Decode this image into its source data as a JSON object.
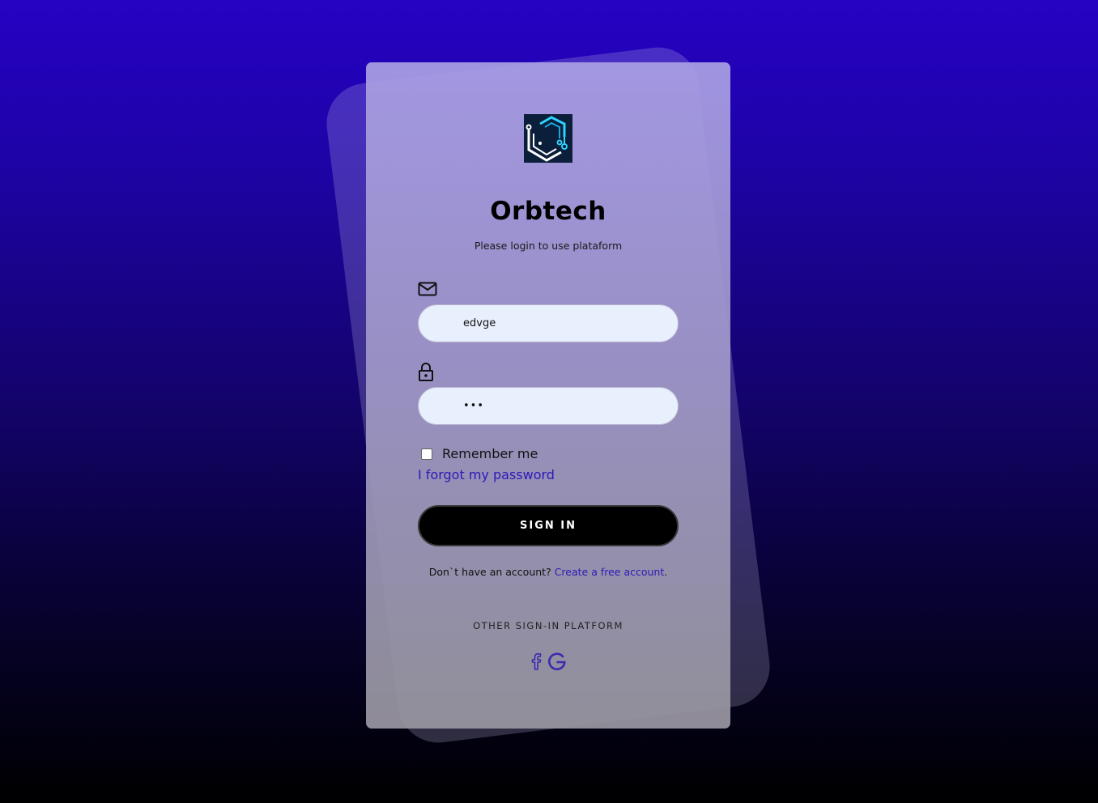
{
  "app": {
    "title": "Orbtech",
    "subtitle": "Please login to use plataform"
  },
  "icons": {
    "logo": "orbtech-logo",
    "email": "mail-icon",
    "password": "lock-icon",
    "facebook": "facebook-icon",
    "google": "google-icon"
  },
  "form": {
    "email_value": "edvge",
    "password_value": "•••",
    "remember_label": "Remember me",
    "remember_checked": false,
    "forgot_label": "I forgot my password",
    "signin_label": "SIGN IN"
  },
  "signup": {
    "prompt": "Don`t have an account?",
    "link": "Create a free account",
    "suffix": "."
  },
  "other_platforms": {
    "heading": "OTHER SIGN-IN PLATFORM"
  },
  "colors": {
    "accent_link": "#2a1ab8",
    "social_icons": "#3a2bb0",
    "button_bg": "#000000",
    "input_bg": "#e8effd"
  }
}
